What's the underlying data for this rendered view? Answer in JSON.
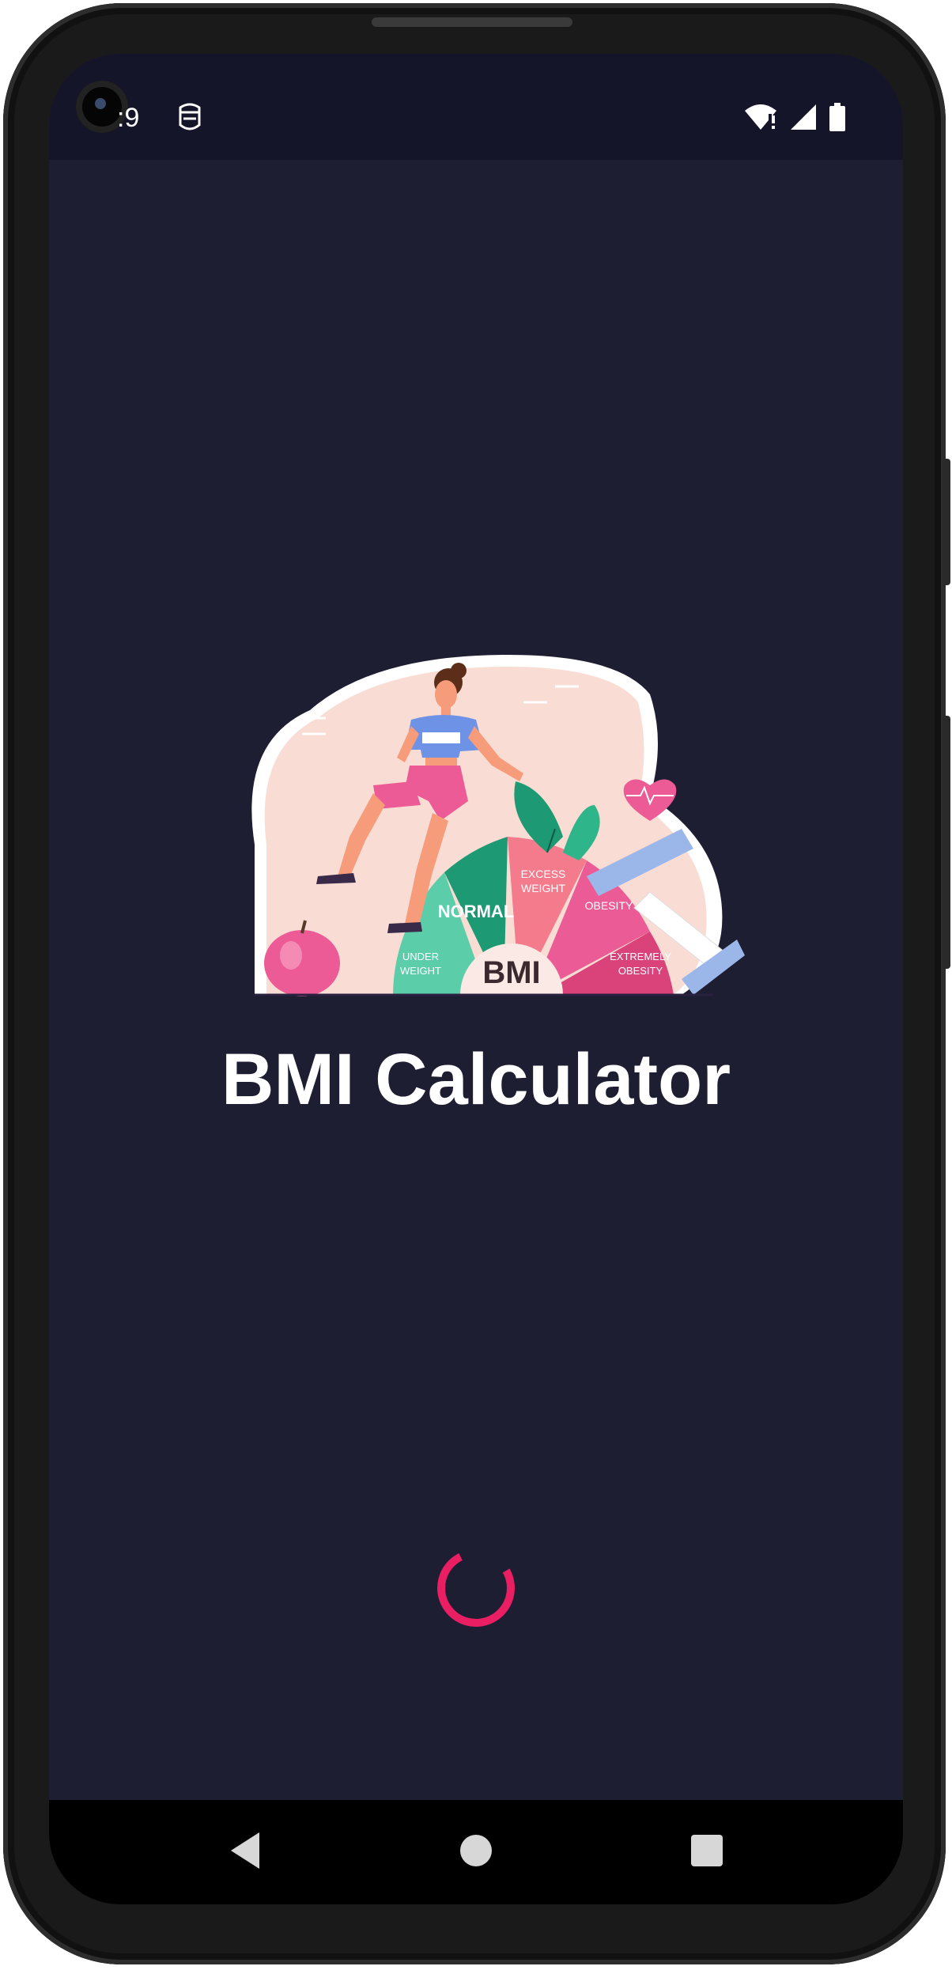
{
  "status_bar": {
    "time": ":9",
    "icons": [
      "wifi-alert-icon",
      "signal-icon",
      "battery-icon"
    ]
  },
  "hero": {
    "illustration": "bmi-illustration",
    "gauge_labels": {
      "normal": "NORMAL",
      "excess": "EXCESS WEIGHT",
      "obesity": "OBESITY",
      "under": "UNDER WEIGHT",
      "extreme": "EXTREMELY OBESITY",
      "center": "BMI"
    }
  },
  "title": "BMI Calculator",
  "loader": {
    "color": "#e91e63"
  },
  "nav": {
    "back": "back-icon",
    "home": "home-icon",
    "recents": "recents-icon"
  },
  "colors": {
    "background": "#1e1e32",
    "accent": "#e91e63"
  }
}
